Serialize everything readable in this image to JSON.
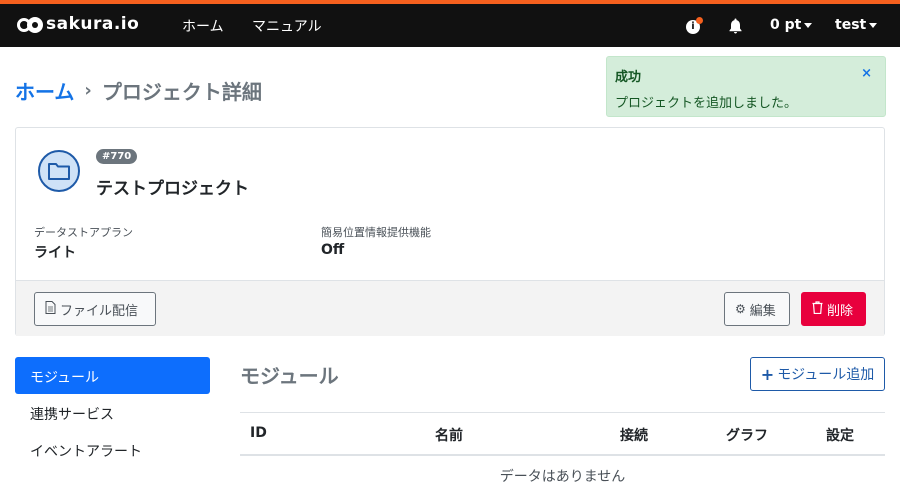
{
  "navbar": {
    "brand": "sakura.io",
    "links": [
      "ホーム",
      "マニュアル"
    ],
    "points": "0 pt",
    "user": "test",
    "icons": [
      "info-icon",
      "bell-icon"
    ],
    "accent_color": "#f5601e"
  },
  "breadcrumb": {
    "home": "ホーム",
    "separator": "›",
    "current": "プロジェクト詳細"
  },
  "alert": {
    "title": "成功",
    "message": "プロジェクトを追加しました。",
    "close": "×"
  },
  "project": {
    "badge": "#770",
    "name": "テストプロジェクト",
    "fields": [
      {
        "label": "データストアプラン",
        "value": "ライト"
      },
      {
        "label": "簡易位置情報提供機能",
        "value": "Off"
      }
    ],
    "buttons": {
      "file": "ファイル配信",
      "edit": "編集",
      "delete": "削除"
    }
  },
  "sidebar": {
    "items": [
      {
        "label": "モジュール",
        "active": true
      },
      {
        "label": "連携サービス",
        "active": false
      },
      {
        "label": "イベントアラート",
        "active": false
      }
    ]
  },
  "modules": {
    "title": "モジュール",
    "add_button": "モジュール追加",
    "columns": [
      "ID",
      "名前",
      "接続",
      "グラフ",
      "設定"
    ],
    "empty": "データはありません"
  },
  "colors": {
    "primary": "#0d6efd",
    "link": "#1473e6",
    "danger": "#e8003d",
    "success_bg": "#d4edda"
  }
}
